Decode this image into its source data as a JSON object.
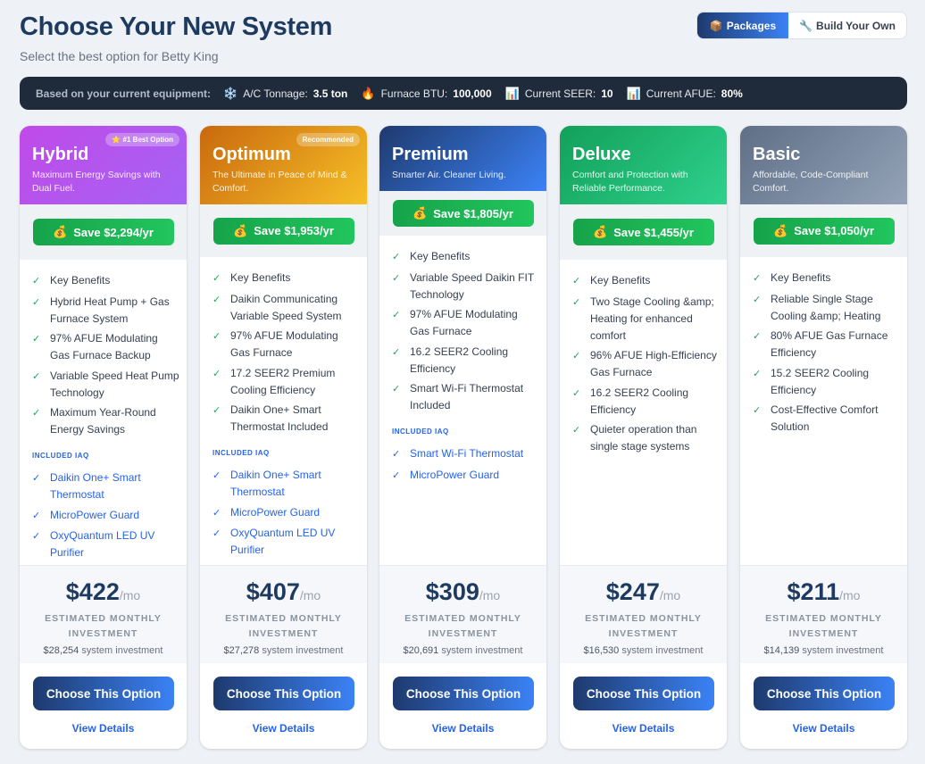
{
  "header": {
    "title": "Choose Your New System",
    "subtitle": "Select the best option for Betty King"
  },
  "view_toggle": {
    "packages_icon": "📦",
    "packages_label": "Packages",
    "build_icon": "🔧",
    "build_label": "Build Your Own",
    "active": "packages"
  },
  "equipment": {
    "lead": "Based on your current equipment:",
    "items": [
      {
        "icon": "❄️",
        "label": "A/C Tonnage:",
        "value": "3.5 ton"
      },
      {
        "icon": "🔥",
        "label": "Furnace BTU:",
        "value": "100,000"
      },
      {
        "icon": "📊",
        "label": "Current SEER:",
        "value": "10"
      },
      {
        "icon": "📊",
        "label": "Current AFUE:",
        "value": "80%"
      }
    ]
  },
  "labels": {
    "money_icon": "💰",
    "check": "✓",
    "included_iaq": "INCLUDED IAQ",
    "per_month": "/mo",
    "estimated": "ESTIMATED MONTHLY INVESTMENT",
    "system_investment": "system investment",
    "choose": "Choose This Option",
    "view": "View Details"
  },
  "packages": [
    {
      "name": "Hybrid",
      "tagline": "Maximum Energy Savings with Dual Fuel.",
      "badge": "⭐ #1 Best Option",
      "savings": "Save $2,294/yr",
      "features": [
        "Key Benefits",
        "Hybrid Heat Pump + Gas Furnace System",
        "97% AFUE Modulating Gas Furnace Backup",
        "Variable Speed Heat Pump Technology",
        "Maximum Year-Round Energy Savings"
      ],
      "iaq": [
        "Daikin One+ Smart Thermostat",
        "MicroPower Guard",
        "OxyQuantum LED UV Purifier"
      ],
      "price": "$422",
      "system": "$28,254",
      "colors": [
        "#c04ae8",
        "#a463f5"
      ]
    },
    {
      "name": "Optimum",
      "tagline": "The Ultimate in Peace of Mind & Comfort.",
      "badge": "Recommended",
      "savings": "Save $1,953/yr",
      "features": [
        "Key Benefits",
        "Daikin Communicating Variable Speed System",
        "97% AFUE Modulating Gas Furnace",
        "17.2 SEER2 Premium Cooling Efficiency",
        "Daikin One+ Smart Thermostat Included"
      ],
      "iaq": [
        "Daikin One+ Smart Thermostat",
        "MicroPower Guard",
        "OxyQuantum LED UV Purifier"
      ],
      "price": "$407",
      "system": "$27,278",
      "colors": [
        "#c9690e",
        "#f6bf26"
      ]
    },
    {
      "name": "Premium",
      "tagline": "Smarter Air. Cleaner Living.",
      "savings": "Save $1,805/yr",
      "features": [
        "Key Benefits",
        "Variable Speed Daikin FIT Technology",
        "97% AFUE Modulating Gas Furnace",
        "16.2 SEER2 Cooling Efficiency",
        "Smart Wi-Fi Thermostat Included"
      ],
      "iaq": [
        "Smart Wi-Fi Thermostat",
        "MicroPower Guard"
      ],
      "price": "$309",
      "system": "$20,691",
      "colors": [
        "#1e3a6e",
        "#3b82f6"
      ]
    },
    {
      "name": "Deluxe",
      "tagline": "Comfort and Protection with Reliable Performance.",
      "savings": "Save $1,455/yr",
      "features": [
        "Key Benefits",
        "Two Stage Cooling &amp; Heating for enhanced comfort",
        "96% AFUE High-Efficiency Gas Furnace",
        "16.2 SEER2 Cooling Efficiency",
        "Quieter operation than single stage systems"
      ],
      "iaq": [],
      "price": "$247",
      "system": "$16,530",
      "colors": [
        "#12a05a",
        "#2fd18d"
      ]
    },
    {
      "name": "Basic",
      "tagline": "Affordable, Code-Compliant Comfort.",
      "savings": "Save $1,050/yr",
      "features": [
        "Key Benefits",
        "Reliable Single Stage Cooling &amp; Heating",
        "80% AFUE Gas Furnace Efficiency",
        "15.2 SEER2 Cooling Efficiency",
        "Cost-Effective Comfort Solution"
      ],
      "iaq": [],
      "price": "$211",
      "system": "$14,139",
      "colors": [
        "#5f6f86",
        "#94a3b8"
      ]
    }
  ]
}
